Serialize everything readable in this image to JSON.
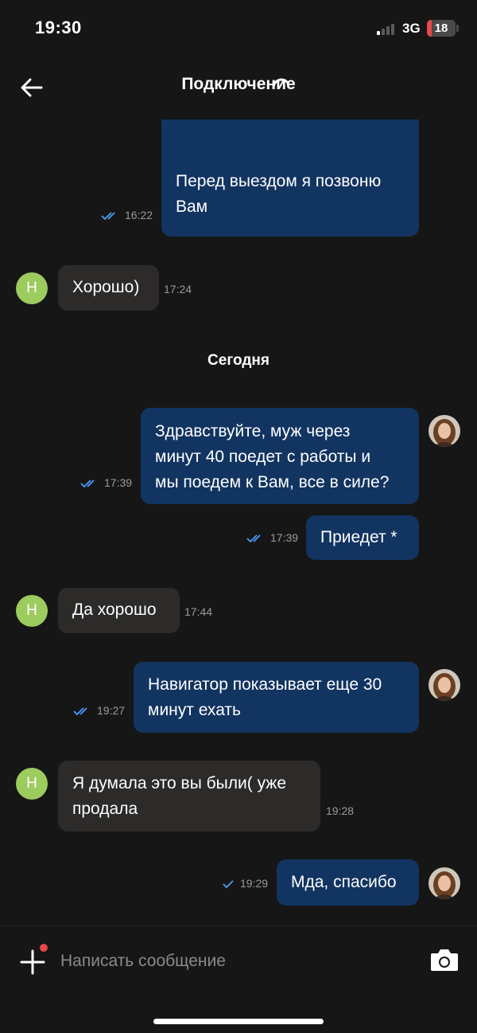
{
  "status": {
    "time": "19:30",
    "network": "3G",
    "battery": "18",
    "battery_level": 0.18,
    "accent": "#e5484d"
  },
  "header": {
    "title": "Подключение",
    "back_icon": "arrow-left-icon",
    "loading_icon": "spinner-icon"
  },
  "messages": [
    {
      "dir": "out",
      "lines": [
        "Перед выездом я позвоню",
        "Вам"
      ],
      "time": "16:22",
      "status": "read"
    },
    {
      "dir": "in",
      "avatar": "Н",
      "lines": [
        "Хорошо)"
      ],
      "time": "17:24"
    },
    {
      "dir": "out",
      "lines": [
        "Здравствуйте, муж через",
        "минут 40 поедет с работы и",
        "мы поедем к Вам, все в силе?"
      ],
      "time": "17:39",
      "status": "read"
    },
    {
      "dir": "out",
      "lines": [
        "Приедет *"
      ],
      "time": "17:39",
      "status": "read"
    },
    {
      "dir": "in",
      "avatar": "Н",
      "lines": [
        "Да хорошо"
      ],
      "time": "17:44"
    },
    {
      "dir": "out",
      "lines": [
        "Навигатор показывает еще 30",
        "минут ехать"
      ],
      "time": "19:27",
      "status": "read"
    },
    {
      "dir": "in",
      "avatar": "Н",
      "lines": [
        "Я думала это вы были( уже",
        "продала"
      ],
      "time": "19:28"
    },
    {
      "dir": "out",
      "lines": [
        "Мда, спасибо"
      ],
      "time": "19:29",
      "status": "sent"
    }
  ],
  "day_separator": "Сегодня",
  "composer": {
    "placeholder": "Написать сообщение",
    "attach_icon": "plus-icon",
    "camera_icon": "camera-icon"
  },
  "colors": {
    "outgoing": "#123461",
    "incoming": "#2d2b29",
    "avatar": "#9ccb5e",
    "ticks": "#4a9eff"
  }
}
